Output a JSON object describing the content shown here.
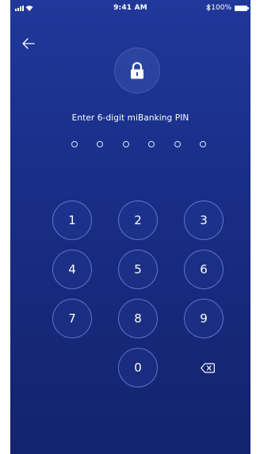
{
  "status_bar": {
    "time": "9:41 AM",
    "bluetooth_icon": "bluetooth-icon",
    "battery_percent": "100%"
  },
  "header": {
    "back_icon": "arrow-left-icon",
    "lock_icon": "lock-icon"
  },
  "prompt": {
    "text": "Enter 6-digit miBanking PIN"
  },
  "pin": {
    "length": 6,
    "entered": 0
  },
  "keypad": {
    "keys": [
      "1",
      "2",
      "3",
      "4",
      "5",
      "6",
      "7",
      "8",
      "9",
      "0"
    ],
    "backspace_icon": "backspace-icon"
  },
  "colors": {
    "background_top": "#20389a",
    "background_bottom": "#13236e",
    "text": "#ffffff",
    "key_border": "#96afff"
  }
}
